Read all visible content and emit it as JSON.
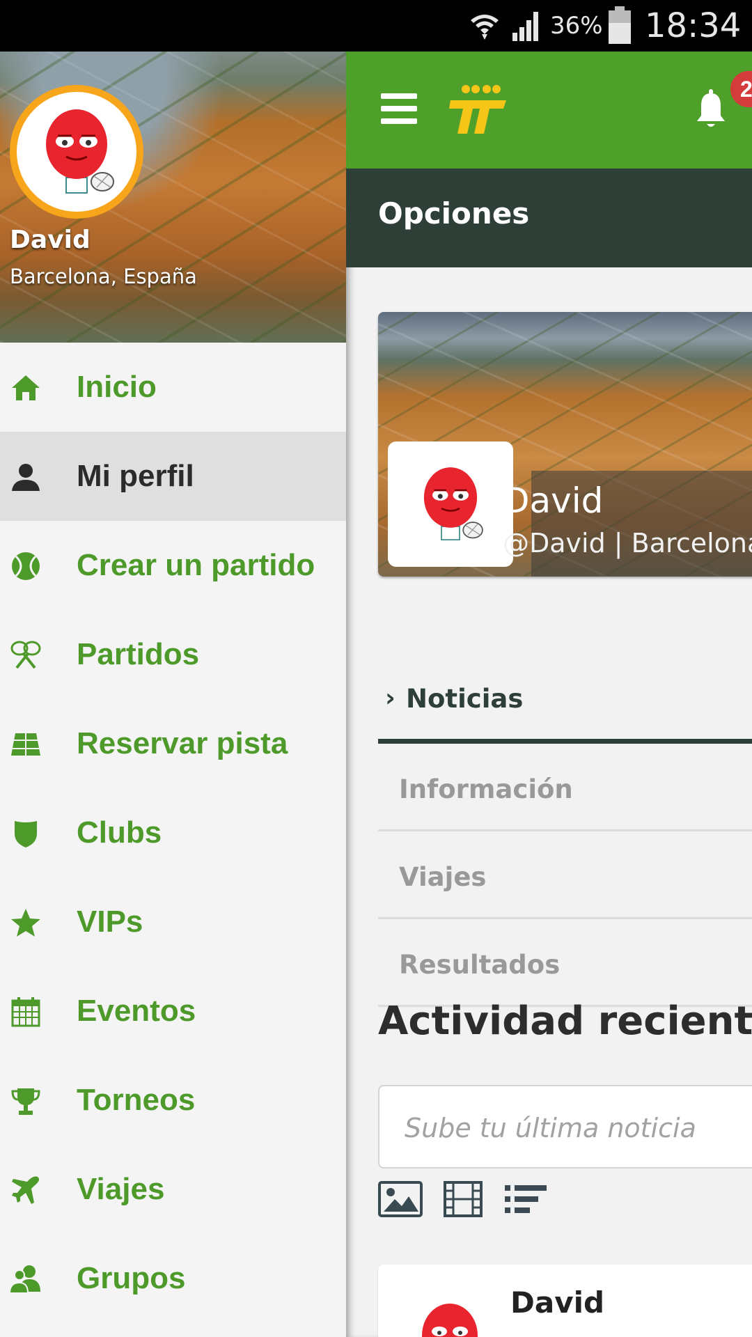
{
  "status_bar": {
    "battery_percent": "36%",
    "time": "18:34"
  },
  "drawer": {
    "user_name": "David",
    "user_location": "Barcelona, España",
    "items": [
      {
        "label": "Inicio",
        "icon": "home-icon"
      },
      {
        "label": "Mi perfil",
        "icon": "user-icon",
        "active": true
      },
      {
        "label": "Crear un partido",
        "icon": "tennis-ball-icon"
      },
      {
        "label": "Partidos",
        "icon": "rackets-icon"
      },
      {
        "label": "Reservar pista",
        "icon": "court-icon"
      },
      {
        "label": "Clubs",
        "icon": "shield-icon"
      },
      {
        "label": "VIPs",
        "icon": "star-icon"
      },
      {
        "label": "Eventos",
        "icon": "calendar-icon"
      },
      {
        "label": "Torneos",
        "icon": "trophy-icon"
      },
      {
        "label": "Viajes",
        "icon": "plane-icon"
      },
      {
        "label": "Grupos",
        "icon": "group-icon"
      }
    ]
  },
  "header": {
    "notification_count": "2"
  },
  "options_bar": {
    "title": "Opciones"
  },
  "profile": {
    "name": "David",
    "handle": "@David | Barcelona, España"
  },
  "tabs": [
    {
      "label": "Noticias",
      "active": true
    },
    {
      "label": "Información"
    },
    {
      "label": "Viajes"
    },
    {
      "label": "Resultados"
    }
  ],
  "activity": {
    "title": "Actividad reciente",
    "input_placeholder": "Sube tu última noticia",
    "feed_author": "David"
  },
  "colors": {
    "brand_green": "#4f9f2b",
    "dark_bar": "#2e3f37",
    "badge_red": "#d43c3c",
    "avatar_ring": "#f7a51a",
    "logo_yellow": "#f5c518"
  }
}
